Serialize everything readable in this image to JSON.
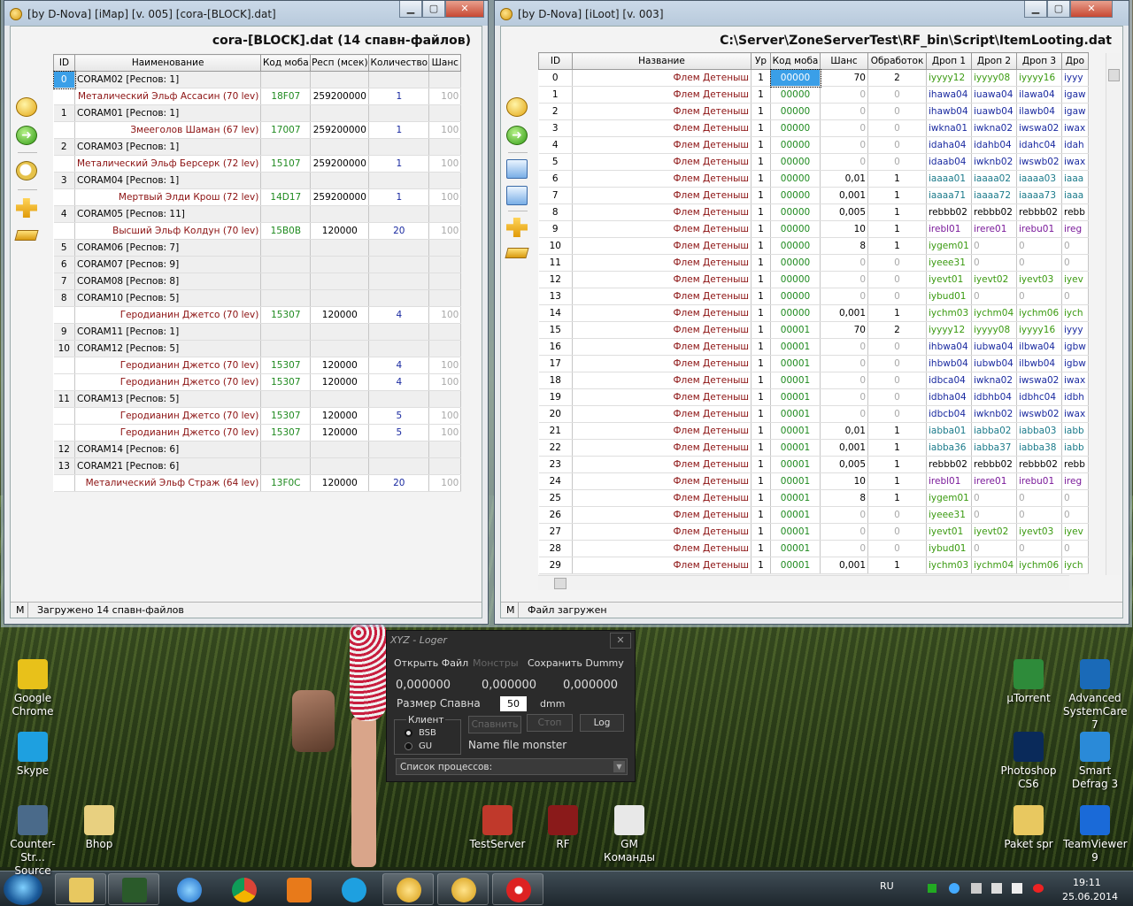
{
  "imap": {
    "title": "[by D-Nova] [iMap] [v. 005] [cora-[BLOCK].dat]",
    "header": "cora-[BLOCK].dat (14 спавн-файлов)",
    "status_m": "M",
    "status": "Загружено 14 спавн-файлов",
    "columns": [
      "ID",
      "Наименование",
      "Код моба",
      "Респ (мсек)",
      "Количество",
      "Шанс"
    ],
    "rows": [
      {
        "g": true,
        "id": "0",
        "name": "CORAM02 [Респов: 1]"
      },
      {
        "g": false,
        "id": "",
        "name": "Металический Эльф Ассасин (70 lev)",
        "code": "18F07",
        "resp": "259200000",
        "qty": "1",
        "ch": "100"
      },
      {
        "g": true,
        "id": "1",
        "name": "CORAM01 [Респов: 1]"
      },
      {
        "g": false,
        "id": "",
        "name": "Змееголов Шаман (67 lev)",
        "code": "17007",
        "resp": "259200000",
        "qty": "1",
        "ch": "100"
      },
      {
        "g": true,
        "id": "2",
        "name": "CORAM03 [Респов: 1]"
      },
      {
        "g": false,
        "id": "",
        "name": "Металический Эльф Берсерк (72 lev)",
        "code": "15107",
        "resp": "259200000",
        "qty": "1",
        "ch": "100"
      },
      {
        "g": true,
        "id": "3",
        "name": "CORAM04 [Респов: 1]"
      },
      {
        "g": false,
        "id": "",
        "name": "Мертвый Элди Крош (72 lev)",
        "code": "14D17",
        "resp": "259200000",
        "qty": "1",
        "ch": "100"
      },
      {
        "g": true,
        "id": "4",
        "name": "CORAM05 [Респов: 11]"
      },
      {
        "g": false,
        "id": "",
        "name": "Высший Эльф Колдун (70 lev)",
        "code": "15B0B",
        "resp": "120000",
        "qty": "20",
        "ch": "100"
      },
      {
        "g": true,
        "id": "5",
        "name": "CORAM06 [Респов: 7]"
      },
      {
        "g": true,
        "id": "6",
        "name": "CORAM07 [Респов: 9]"
      },
      {
        "g": true,
        "id": "7",
        "name": "CORAM08 [Респов: 8]"
      },
      {
        "g": true,
        "id": "8",
        "name": "CORAM10 [Респов: 5]"
      },
      {
        "g": false,
        "id": "",
        "name": "Геродианин Джетсо (70 lev)",
        "code": "15307",
        "resp": "120000",
        "qty": "4",
        "ch": "100"
      },
      {
        "g": true,
        "id": "9",
        "name": "CORAM11 [Респов: 1]"
      },
      {
        "g": true,
        "id": "10",
        "name": "CORAM12 [Респов: 5]"
      },
      {
        "g": false,
        "id": "",
        "name": "Геродианин Джетсо (70 lev)",
        "code": "15307",
        "resp": "120000",
        "qty": "4",
        "ch": "100"
      },
      {
        "g": false,
        "id": "",
        "name": "Геродианин Джетсо (70 lev)",
        "code": "15307",
        "resp": "120000",
        "qty": "4",
        "ch": "100"
      },
      {
        "g": true,
        "id": "11",
        "name": "CORAM13 [Респов: 5]"
      },
      {
        "g": false,
        "id": "",
        "name": "Геродианин Джетсо (70 lev)",
        "code": "15307",
        "resp": "120000",
        "qty": "5",
        "ch": "100"
      },
      {
        "g": false,
        "id": "",
        "name": "Геродианин Джетсо (70 lev)",
        "code": "15307",
        "resp": "120000",
        "qty": "5",
        "ch": "100"
      },
      {
        "g": true,
        "id": "12",
        "name": "CORAM14 [Респов: 6]"
      },
      {
        "g": true,
        "id": "13",
        "name": "CORAM21 [Респов: 6]"
      },
      {
        "g": false,
        "id": "",
        "name": "Металический Эльф Страж (64 lev)",
        "code": "13F0C",
        "resp": "120000",
        "qty": "20",
        "ch": "100"
      }
    ]
  },
  "iloot": {
    "title": "[by D-Nova] [iLoot] [v. 003]",
    "header": "C:\\Server\\ZoneServerTest\\RF_bin\\Script\\ItemLooting.dat",
    "status_m": "M",
    "status": "Файл загружен",
    "columns": [
      "ID",
      "Название",
      "Ур",
      "Код моба",
      "Шанс",
      "Обработок",
      "Дроп 1",
      "Дроп 2",
      "Дроп 3",
      "Дро"
    ],
    "rows": [
      [
        "0",
        "Флем Детеныш",
        "1",
        "00000",
        "70",
        "2",
        "iyyyy12",
        "iyyyy08",
        "iyyyy16",
        "iyyy"
      ],
      [
        "1",
        "Флем Детеныш",
        "1",
        "00000",
        "0",
        "0",
        "ihawa04",
        "iuawa04",
        "ilawa04",
        "igaw"
      ],
      [
        "2",
        "Флем Детеныш",
        "1",
        "00000",
        "0",
        "0",
        "ihawb04",
        "iuawb04",
        "ilawb04",
        "igaw"
      ],
      [
        "3",
        "Флем Детеныш",
        "1",
        "00000",
        "0",
        "0",
        "iwkna01",
        "iwkna02",
        "iwswa02",
        "iwax"
      ],
      [
        "4",
        "Флем Детеныш",
        "1",
        "00000",
        "0",
        "0",
        "idaha04",
        "idahb04",
        "idahc04",
        "idah"
      ],
      [
        "5",
        "Флем Детеныш",
        "1",
        "00000",
        "0",
        "0",
        "idaab04",
        "iwknb02",
        "iwswb02",
        "iwax"
      ],
      [
        "6",
        "Флем Детеныш",
        "1",
        "00000",
        "0,01",
        "1",
        "iaaaa01",
        "iaaaa02",
        "iaaaa03",
        "iaaa"
      ],
      [
        "7",
        "Флем Детеныш",
        "1",
        "00000",
        "0,001",
        "1",
        "iaaaa71",
        "iaaaa72",
        "iaaaa73",
        "iaaa"
      ],
      [
        "8",
        "Флем Детеныш",
        "1",
        "00000",
        "0,005",
        "1",
        "rebbb02",
        "rebbb02",
        "rebbb02",
        "rebb"
      ],
      [
        "9",
        "Флем Детеныш",
        "1",
        "00000",
        "10",
        "1",
        "irebl01",
        "irere01",
        "irebu01",
        "ireg"
      ],
      [
        "10",
        "Флем Детеныш",
        "1",
        "00000",
        "8",
        "1",
        "iygem01",
        "0",
        "0",
        "0"
      ],
      [
        "11",
        "Флем Детеныш",
        "1",
        "00000",
        "0",
        "0",
        "iyeee31",
        "0",
        "0",
        "0"
      ],
      [
        "12",
        "Флем Детеныш",
        "1",
        "00000",
        "0",
        "0",
        "iyevt01",
        "iyevt02",
        "iyevt03",
        "iyev"
      ],
      [
        "13",
        "Флем Детеныш",
        "1",
        "00000",
        "0",
        "0",
        "iybud01",
        "0",
        "0",
        "0"
      ],
      [
        "14",
        "Флем Детеныш",
        "1",
        "00000",
        "0,001",
        "1",
        "iychm03",
        "iychm04",
        "iychm06",
        "iych"
      ],
      [
        "15",
        "Флем Детеныш",
        "1",
        "00001",
        "70",
        "2",
        "iyyyy12",
        "iyyyy08",
        "iyyyy16",
        "iyyy"
      ],
      [
        "16",
        "Флем Детеныш",
        "1",
        "00001",
        "0",
        "0",
        "ihbwa04",
        "iubwa04",
        "ilbwa04",
        "igbw"
      ],
      [
        "17",
        "Флем Детеныш",
        "1",
        "00001",
        "0",
        "0",
        "ihbwb04",
        "iubwb04",
        "ilbwb04",
        "igbw"
      ],
      [
        "18",
        "Флем Детеныш",
        "1",
        "00001",
        "0",
        "0",
        "idbca04",
        "iwkna02",
        "iwswa02",
        "iwax"
      ],
      [
        "19",
        "Флем Детеныш",
        "1",
        "00001",
        "0",
        "0",
        "idbha04",
        "idbhb04",
        "idbhc04",
        "idbh"
      ],
      [
        "20",
        "Флем Детеныш",
        "1",
        "00001",
        "0",
        "0",
        "idbcb04",
        "iwknb02",
        "iwswb02",
        "iwax"
      ],
      [
        "21",
        "Флем Детеныш",
        "1",
        "00001",
        "0,01",
        "1",
        "iabba01",
        "iabba02",
        "iabba03",
        "iabb"
      ],
      [
        "22",
        "Флем Детеныш",
        "1",
        "00001",
        "0,001",
        "1",
        "iabba36",
        "iabba37",
        "iabba38",
        "iabb"
      ],
      [
        "23",
        "Флем Детеныш",
        "1",
        "00001",
        "0,005",
        "1",
        "rebbb02",
        "rebbb02",
        "rebbb02",
        "rebb"
      ],
      [
        "24",
        "Флем Детеныш",
        "1",
        "00001",
        "10",
        "1",
        "irebl01",
        "irere01",
        "irebu01",
        "ireg"
      ],
      [
        "25",
        "Флем Детеныш",
        "1",
        "00001",
        "8",
        "1",
        "iygem01",
        "0",
        "0",
        "0"
      ],
      [
        "26",
        "Флем Детеныш",
        "1",
        "00001",
        "0",
        "0",
        "iyeee31",
        "0",
        "0",
        "0"
      ],
      [
        "27",
        "Флем Детеныш",
        "1",
        "00001",
        "0",
        "0",
        "iyevt01",
        "iyevt02",
        "iyevt03",
        "iyev"
      ],
      [
        "28",
        "Флем Детеныш",
        "1",
        "00001",
        "0",
        "0",
        "iybud01",
        "0",
        "0",
        "0"
      ],
      [
        "29",
        "Флем Детеныш",
        "1",
        "00001",
        "0,001",
        "1",
        "iychm03",
        "iychm04",
        "iychm06",
        "iych"
      ]
    ]
  },
  "logger": {
    "title": "XYZ - Loger",
    "close": "✕",
    "menu_open": "Открыть Файл",
    "menu_monsters": "Монстры",
    "menu_save": "Сохранить Dummy",
    "x": "0,000000",
    "y": "0,000000",
    "z": "0,000000",
    "size_label": "Размер Спавна",
    "size_value": "50",
    "size_unit": "dmm",
    "client_label": "Клиент",
    "radio_bsb": "BSB",
    "radio_gu": "GU",
    "btn_spawn": "Спавнить",
    "btn_stop": "Стоп",
    "btn_log": "Log",
    "name_file": "Name file monster",
    "process_list": "Список процессов:"
  },
  "desktop": {
    "left": [
      {
        "label": "Google Chrome",
        "color": "#e8c11a"
      },
      {
        "label": "Skype",
        "color": "#1ea0e0"
      },
      {
        "label": "Counter-Str... Source",
        "color": "#4a6a8a"
      },
      {
        "label": "Bhop",
        "color": "#e8d080"
      }
    ],
    "middle": [
      {
        "label": "TestServer",
        "color": "#c0392b"
      },
      {
        "label": "RF",
        "color": "#8a1a1a"
      },
      {
        "label": "GM Команды",
        "color": "#e8e8e8"
      }
    ],
    "right": [
      {
        "label": "µTorrent",
        "color": "#2e8b3a"
      },
      {
        "label": "Advanced SystemCare 7",
        "color": "#1a6ab8"
      },
      {
        "label": "Photoshop CS6",
        "color": "#0a2a5a"
      },
      {
        "label": "Smart Defrag 3",
        "color": "#2a8ad8"
      },
      {
        "label": "Paket spr",
        "color": "#e8c860"
      },
      {
        "label": "TeamViewer 9",
        "color": "#1a6ad8"
      }
    ]
  },
  "taskbar": {
    "lang": "RU",
    "time": "19:11",
    "date": "25.06.2014"
  }
}
